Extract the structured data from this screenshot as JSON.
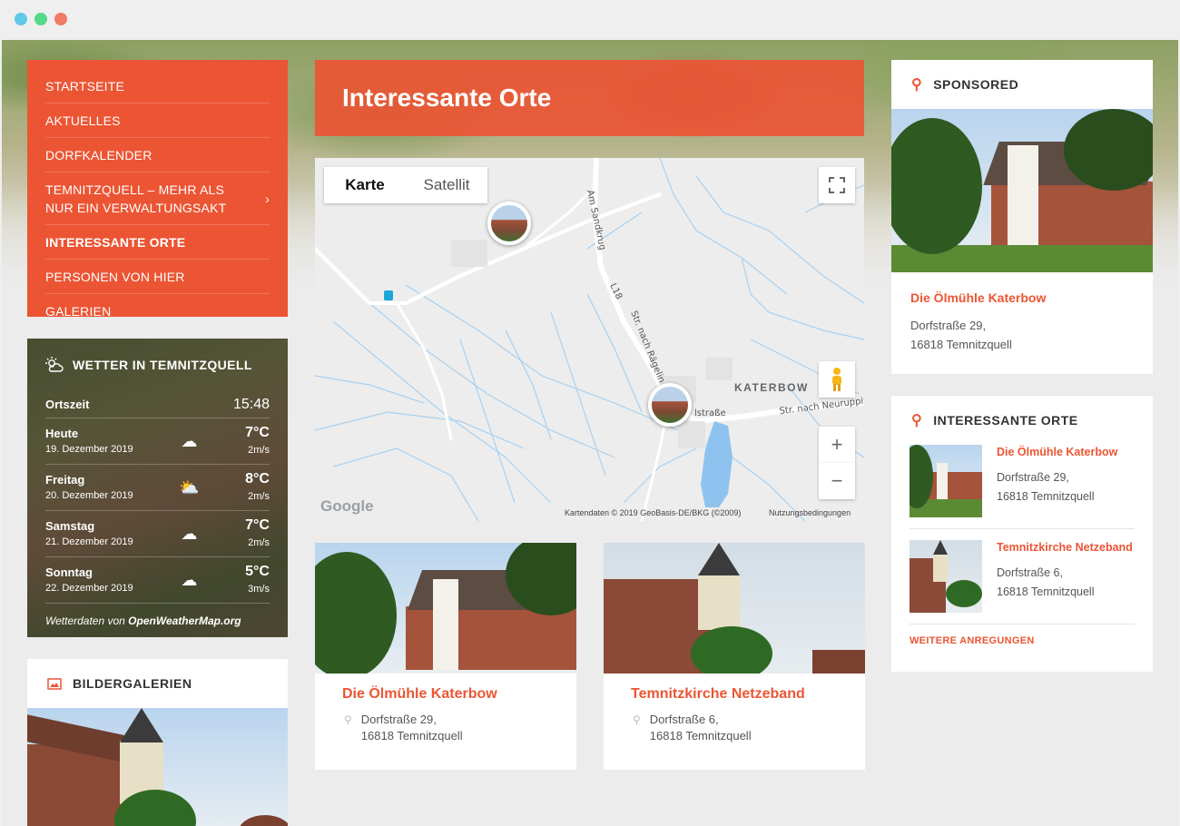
{
  "window": {
    "dots": [
      "#60c9ea",
      "#55d98a",
      "#f07a63"
    ]
  },
  "menu": {
    "items": [
      {
        "label": "STARTSEITE",
        "active": false
      },
      {
        "label": "AKTUELLES",
        "active": false
      },
      {
        "label": "DORFKALENDER",
        "active": false
      },
      {
        "label": "TEMNITZQUELL – MEHR ALS NUR EIN VERWALTUNGSAKT",
        "active": false,
        "chevron": "›"
      },
      {
        "label": "INTERESSANTE ORTE",
        "active": true
      },
      {
        "label": "PERSONEN VON HIER",
        "active": false
      },
      {
        "label": "GALERIEN",
        "active": false
      }
    ]
  },
  "weather": {
    "title": "WETTER IN TEMNITZQUELL",
    "local_label": "Ortszeit",
    "local_time": "15:48",
    "days": [
      {
        "day": "Heute",
        "date": "19. Dezember 2019",
        "icon": "cloud-icon",
        "temp": "7°C",
        "wind": "2m/s"
      },
      {
        "day": "Freitag",
        "date": "20. Dezember 2019",
        "icon": "sun-cloud-icon",
        "temp": "8°C",
        "wind": "2m/s"
      },
      {
        "day": "Samstag",
        "date": "21. Dezember 2019",
        "icon": "cloud-icon",
        "temp": "7°C",
        "wind": "2m/s"
      },
      {
        "day": "Sonntag",
        "date": "22. Dezember 2019",
        "icon": "cloud-icon",
        "temp": "5°C",
        "wind": "3m/s"
      }
    ],
    "credit_prefix": "Wetterdaten von ",
    "credit_source": "OpenWeatherMap.org"
  },
  "gallery": {
    "title": "BILDERGALERIEN"
  },
  "main": {
    "title": "Interessante Orte"
  },
  "map": {
    "tab_map": "Karte",
    "tab_satellite": "Satellit",
    "place_label": "KATERBOW",
    "roads": [
      "Am Sandkrug",
      "L18",
      "Str. nach Rägelin",
      "Str. nach Neuruppin",
      "lstraße"
    ],
    "footer_data": "Kartendaten © 2019 GeoBasis-DE/BKG (©2009)",
    "footer_terms": "Nutzungsbedingungen",
    "logo": "Google",
    "zoom_in": "+",
    "zoom_out": "−"
  },
  "cards": [
    {
      "title": "Die Ölmühle Katerbow",
      "street": "Dorfstraße 29,",
      "city": "16818 Temnitzquell"
    },
    {
      "title": "Temnitzkirche Netzeband",
      "street": "Dorfstraße 6,",
      "city": "16818 Temnitzquell"
    }
  ],
  "sponsored": {
    "heading": "SPONSORED",
    "title": "Die Ölmühle Katerbow",
    "street": "Dorfstraße 29,",
    "city": "16818 Temnitzquell"
  },
  "orte": {
    "heading": "INTERESSANTE ORTE",
    "items": [
      {
        "title": "Die Ölmühle Katerbow",
        "street": "Dorfstraße 29,",
        "city": "16818 Temnitzquell"
      },
      {
        "title": "Temnitzkirche Netzeband",
        "street": "Dorfstraße 6,",
        "city": "16818 Temnitzquell"
      }
    ],
    "more": "WEITERE ANREGUNGEN"
  },
  "colors": {
    "accent": "#ec5534"
  }
}
